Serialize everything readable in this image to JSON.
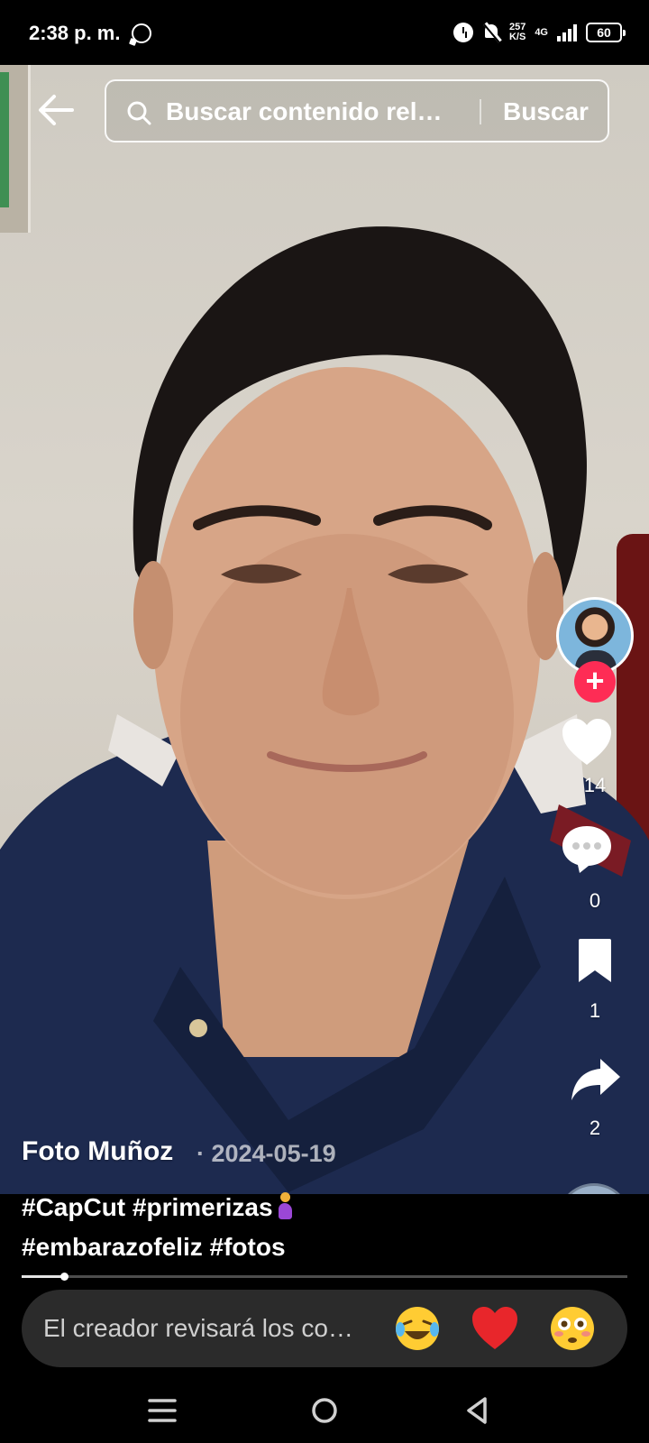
{
  "status_bar": {
    "time": "2:38 p. m.",
    "speed_value": "257",
    "speed_unit": "K/S",
    "network": "4G",
    "battery": "60",
    "icons": [
      "whatsapp-icon",
      "alarm-icon",
      "mute-bell-icon",
      "signal-icon",
      "battery-icon"
    ]
  },
  "search": {
    "placeholder": "Buscar contenido rel…",
    "button_label": "Buscar"
  },
  "rail": {
    "likes": "14",
    "comments": "0",
    "saves": "1",
    "shares": "2",
    "accent_color": "#fe2c55"
  },
  "caption": {
    "author": "Foto Muñoz",
    "date": "· 2024-05-19",
    "hashtags_line1": "#CapCut #primerizas",
    "hashtags_line2": "#embarazofeliz #fotos"
  },
  "progress": {
    "fraction": 0.07
  },
  "comment_bar": {
    "placeholder": "El creador revisará los co…",
    "quick_emojis": [
      "laughing-tears-emoji",
      "red-heart-emoji",
      "flushed-face-emoji"
    ]
  },
  "nav": {
    "icons": [
      "menu-icon",
      "home-icon",
      "back-icon"
    ]
  }
}
